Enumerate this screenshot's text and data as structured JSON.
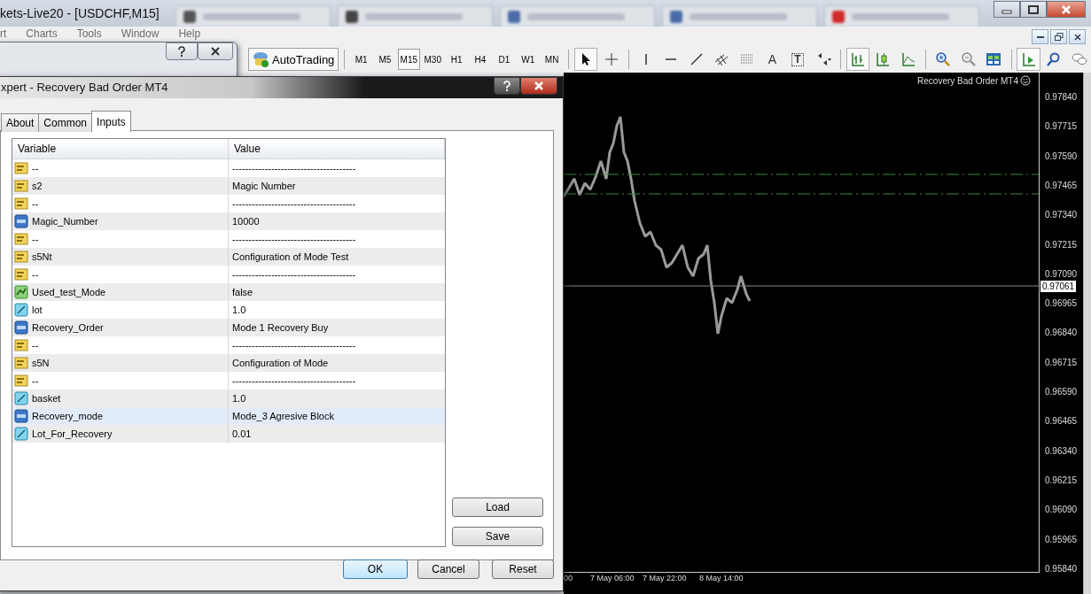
{
  "window": {
    "title": "kets-Live20 - [USDCHF,M15]"
  },
  "menu": [
    "rt",
    "Charts",
    "Tools",
    "Window",
    "Help"
  ],
  "toolbar": {
    "autotrading": "AutoTrading",
    "timeframes": [
      {
        "label": "M1",
        "selected": false
      },
      {
        "label": "M5",
        "selected": false
      },
      {
        "label": "M15",
        "selected": true
      },
      {
        "label": "M30",
        "selected": false
      },
      {
        "label": "H1",
        "selected": false
      },
      {
        "label": "H4",
        "selected": false
      },
      {
        "label": "D1",
        "selected": false
      },
      {
        "label": "W1",
        "selected": false
      },
      {
        "label": "MN",
        "selected": false
      }
    ],
    "text_tool": "A",
    "label_tool": "T"
  },
  "dialog": {
    "title": "xpert - Recovery Bad Order MT4",
    "tabs": [
      {
        "label": "About",
        "selected": false
      },
      {
        "label": "Common",
        "selected": false
      },
      {
        "label": "Inputs",
        "selected": true
      }
    ],
    "columns": [
      "Variable",
      "Value"
    ],
    "rows": [
      {
        "kind": "text",
        "variable": "--",
        "value": "--------------------------------------",
        "selected": false
      },
      {
        "kind": "text",
        "variable": "s2",
        "value": "Magic Number",
        "selected": false
      },
      {
        "kind": "text",
        "variable": "--",
        "value": "--------------------------------------",
        "selected": false
      },
      {
        "kind": "integer",
        "variable": "Magic_Number",
        "value": "10000",
        "selected": false
      },
      {
        "kind": "text",
        "variable": "--",
        "value": "--------------------------------------",
        "selected": false
      },
      {
        "kind": "text",
        "variable": "s5Nt",
        "value": "Configuration of Mode Test",
        "selected": false
      },
      {
        "kind": "text",
        "variable": "--",
        "value": "--------------------------------------",
        "selected": false
      },
      {
        "kind": "bool",
        "variable": "Used_test_Mode",
        "value": "false",
        "selected": false
      },
      {
        "kind": "double",
        "variable": "lot",
        "value": "1.0",
        "selected": false
      },
      {
        "kind": "integer",
        "variable": "Recovery_Order",
        "value": "Mode 1 Recovery Buy",
        "selected": false
      },
      {
        "kind": "text",
        "variable": "--",
        "value": "--------------------------------------",
        "selected": false
      },
      {
        "kind": "text",
        "variable": "s5N",
        "value": "Configuration of Mode",
        "selected": false
      },
      {
        "kind": "text",
        "variable": "--",
        "value": "--------------------------------------",
        "selected": false
      },
      {
        "kind": "double",
        "variable": "basket",
        "value": "1.0",
        "selected": false
      },
      {
        "kind": "integer",
        "variable": "Recovery_mode",
        "value": "Mode_3 Agresive Block",
        "selected": true
      },
      {
        "kind": "double",
        "variable": "Lot_For_Recovery",
        "value": "0.01",
        "selected": false
      }
    ],
    "side_buttons": [
      "Load",
      "Save"
    ],
    "buttons": [
      "OK",
      "Cancel",
      "Reset"
    ]
  },
  "chart": {
    "title": "Recovery Bad Order MT4",
    "current_price": "0.97061",
    "price_axis": [
      "0.97840",
      "0.97715",
      "0.97590",
      "0.97465",
      "0.97340",
      "0.97215",
      "0.97090",
      "0.96965",
      "0.96840",
      "0.96715",
      "0.96590",
      "0.96465",
      "0.96340",
      "0.96215",
      "0.96090",
      "0.95965",
      "0.95840"
    ],
    "time_axis": [
      "00",
      "7 May 06:00",
      "7 May 22:00",
      "8 May 14:00"
    ]
  }
}
